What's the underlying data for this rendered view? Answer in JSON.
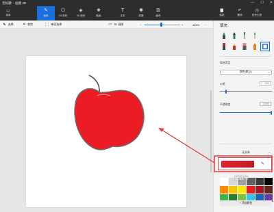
{
  "titlebar": {
    "title": "无标题* - 画图 3D",
    "min": "—",
    "max": "☐",
    "close": "✕"
  },
  "ribbon": {
    "menu_label": "菜单",
    "tools": [
      {
        "label": "画笔",
        "icon": "brush-icon",
        "glyph": "✎",
        "active": true
      },
      {
        "label": "2D 形状",
        "icon": "2d-shapes-icon",
        "glyph": "⬠",
        "active": false
      },
      {
        "label": "3D 形状",
        "icon": "3d-shapes-icon",
        "glyph": "◈",
        "active": false
      },
      {
        "label": "贴纸",
        "icon": "stickers-icon",
        "glyph": "❖",
        "active": false
      },
      {
        "label": "文本",
        "icon": "text-icon",
        "glyph": "T",
        "active": false
      },
      {
        "label": "效果",
        "icon": "effects-icon",
        "glyph": "✺",
        "active": false
      },
      {
        "label": "画布",
        "icon": "canvas-icon",
        "glyph": "⊞",
        "active": false
      }
    ],
    "right": [
      {
        "label": "粘贴",
        "icon": "paste-icon",
        "glyph": "📋"
      },
      {
        "label": "撤消",
        "icon": "undo-icon",
        "glyph": "↶"
      },
      {
        "label": "历史记录",
        "icon": "history-icon",
        "glyph": "◷"
      }
    ]
  },
  "toolbar": {
    "select": "选择",
    "crop": "裁剪",
    "magic_select": "神奇选择",
    "view3d": "3D 视图",
    "zoom_minus": "−",
    "zoom_plus": "+",
    "zoom_value": "100%",
    "zoom_level": 0.45,
    "more": "···"
  },
  "panel": {
    "heading": "填充",
    "fill_type_label": "填充类型",
    "fill_type_value": "颜色(默认)",
    "opacity_label": "公差",
    "opacity_value": "10%",
    "opacity_level": 0.1,
    "transparency_label": "不透明度",
    "transparency_value": "100%",
    "transparency_level": 1.0,
    "nofill": "无光泽",
    "add_color": "添加颜色",
    "selected_color": "#e3202e",
    "palette": [
      "#ffffff",
      "#d7d7d7",
      "#a0a0a0",
      "#606060",
      "#3a3a3a",
      "#000000",
      "#ff8a00",
      "#f6c500",
      "#ffe800",
      "#e61e1e",
      "#a61520",
      "#5d2a17",
      "#3fb54a",
      "#2f7d32",
      "#7cc242",
      "#39c4e6",
      "#1565c0",
      "#6a3da3"
    ],
    "watermark": "搜狐号"
  }
}
